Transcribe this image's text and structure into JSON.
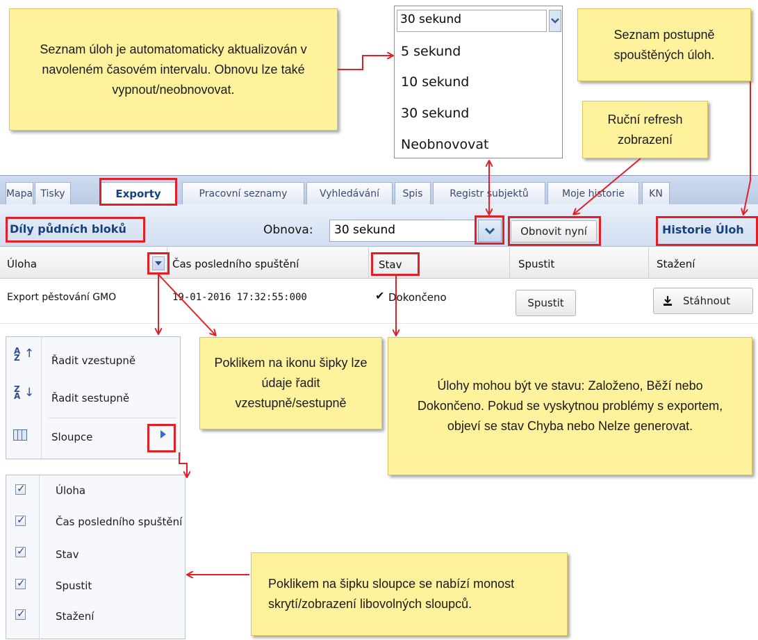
{
  "notes": {
    "auto_refresh": "Seznam úloh je automatomaticky aktualizován v navoleném časovém intervalu. Obnovu lze také vypnout/neobnovovat.",
    "history": "Seznam postupně spouštěných úloh.",
    "manual_refresh": "Ruční refresh zobrazení",
    "sort": "Poklikem na ikonu šipky lze údaje řadit vzestupně/sestupně",
    "states": "Úlohy mohou být ve stavu: Založeno, Běží nebo Dokončeno. Pokud se vyskytnou problémy s exportem, objeví se stav Chyba nebo Nelze generovat.",
    "columns": "Poklikem na šipku sloupce se nabízí monost skrytí/zobrazení libovolných sloupců."
  },
  "refresh_dropdown": {
    "selected": "30 sekund",
    "options": [
      "5 sekund",
      "10 sekund",
      "30 sekund",
      "Neobnovovat"
    ]
  },
  "tabs": [
    {
      "label": "Mapa"
    },
    {
      "label": "Tisky"
    },
    {
      "label": "Exporty"
    },
    {
      "label": "Pracovní seznamy"
    },
    {
      "label": "Vyhledávání"
    },
    {
      "label": "Spis"
    },
    {
      "label": "Registr subjektů"
    },
    {
      "label": "Moje historie"
    },
    {
      "label": "KN"
    }
  ],
  "toolbar": {
    "breadcrumb": "Díly půdních bloků",
    "refresh_label": "Obnova:",
    "refresh_value": "30 sekund",
    "refresh_now": "Obnovit nyní",
    "history": "Historie Úloh"
  },
  "grid": {
    "columns": [
      "Úloha",
      "Čas posledního spuštění",
      "Stav",
      "Spustit",
      "Stažení"
    ],
    "rows": [
      {
        "task": "Export pěstování GMO",
        "last_run": "19-01-2016 17:32:55:000",
        "status": "Dokončeno",
        "run_button": "Spustit",
        "download_button": "Stáhnout"
      }
    ]
  },
  "sort_menu": {
    "asc": "Řadit vzestupně",
    "desc": "Řadit sestupně",
    "columns": "Sloupce"
  },
  "columns_menu": {
    "items": [
      "Úloha",
      "Čas posledního spuštění",
      "Stav",
      "Spustit",
      "Stažení"
    ]
  },
  "colors": {
    "annotation_red": "#e21f26",
    "note_yellow": "#fff29c",
    "header_blue": "#15427d"
  }
}
